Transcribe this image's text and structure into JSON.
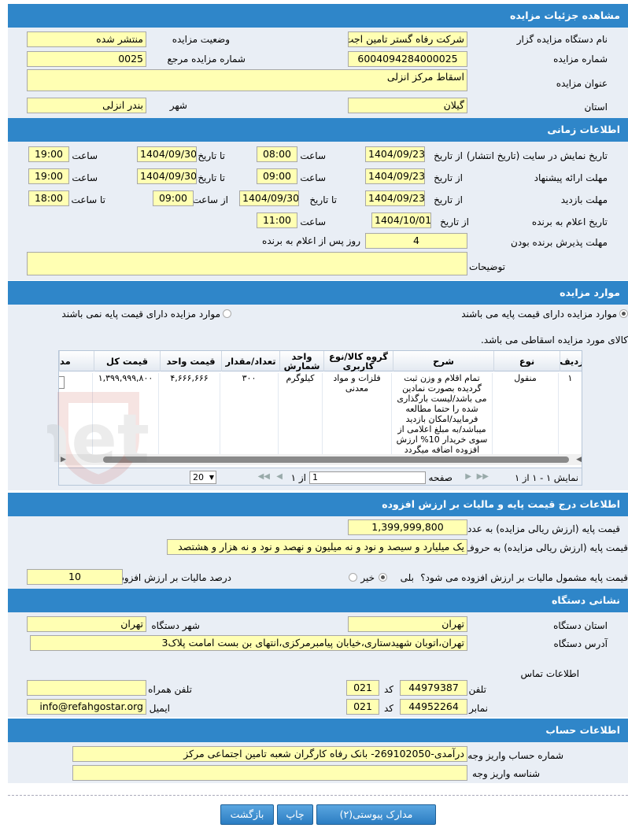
{
  "sections": {
    "details": "مشاهده جزئیات مزایده",
    "time": "اطلاعات زمانی",
    "items": "موارد مزایده",
    "price": "اطلاعات درج قیمت پایه و مالیات بر ارزش افزوده",
    "address": "نشانی دستگاه",
    "account": "اطلاعات حساب"
  },
  "details": {
    "org_label": "نام دستگاه مزایده گزار",
    "org_value": "شرکت رفاه گستر تامین اجت",
    "status_label": "وضعیت مزایده",
    "status_value": "منتشر شده",
    "number_label": "شماره مزایده",
    "number_value": "6004094284000025",
    "ref_label": "شماره مزایده مرجع",
    "ref_value": "0025",
    "title_label": "عنوان مزایده",
    "title_value": "اسقاط مرکز انزلی",
    "province_label": "استان",
    "province_value": "گیلان",
    "city_label": "شهر",
    "city_value": "بندر انزلی"
  },
  "time": {
    "display_label": "تاریخ نمایش در سایت (تاریخ انتشار)",
    "from_date": "از تاریخ",
    "to_date": "تا تاریخ",
    "hour": "ساعت",
    "from_hour": "از ساعت",
    "to_hour": "تا ساعت",
    "display_from": "1404/09/23",
    "display_from_time": "08:00",
    "display_to": "1404/09/30",
    "display_to_time": "19:00",
    "offer_label": "مهلت ارائه پیشنهاد",
    "offer_from": "1404/09/23",
    "offer_from_time": "09:00",
    "offer_to": "1404/09/30",
    "offer_to_time": "19:00",
    "visit_label": "مهلت بازدید",
    "visit_from": "1404/09/23",
    "visit_to": "1404/09/30",
    "visit_from_time": "09:00",
    "visit_to_time": "18:00",
    "winner_label": "تاریخ اعلام به برنده",
    "winner_date": "1404/10/01",
    "winner_time": "11:00",
    "accept_label": "مهلت پذیرش برنده بودن",
    "accept_value": "4",
    "accept_suffix": "روز پس از اعلام به برنده",
    "notes_label": "توضیحات",
    "notes_value": ""
  },
  "items": {
    "radio_with": "موارد مزایده دارای قیمت پایه می باشند",
    "radio_without": "موارد مزایده دارای قیمت پایه نمی باشند",
    "scrap_note": "کالای مورد مزایده اسقاطی می باشد.",
    "headers": {
      "row": "ردیف",
      "type": "نوع",
      "desc": "شرح",
      "group": "گروه کالا/نوع کاربری",
      "unit": "واحد شمارش",
      "qty": "تعداد/مقدار",
      "unit_price": "قیمت واحد",
      "total": "قیمت کل",
      "more": "مد"
    },
    "row": {
      "row": "۱",
      "type": "منقول",
      "desc": "تمام اقلام و وزن ثبت گردیده بصورت نمادین می باشد/لیست بارگذاری شده را حتما مطالعه فرمایید/امکان بازدید میباشد/به مبلغ اعلامی از سوی خریدار 10% ارزش افزوده اضافه میگردد",
      "group": "فلزات و مواد معدنی",
      "unit": "کیلوگرم",
      "qty": "۳۰۰",
      "unit_price": "۴,۶۶۶,۶۶۶",
      "total": "۱,۳۹۹,۹۹۹,۸۰۰"
    },
    "pager": {
      "page_label": "صفحه",
      "page_value": "1",
      "of_label": "از ۱",
      "size_value": "20",
      "summary": "نمایش ۱ - ۱ از ۱"
    }
  },
  "price": {
    "number_label": "قیمت پایه (ارزش ریالی مزایده) به عدد",
    "number_value": "1,399,999,800",
    "words_label": "قیمت پایه (ارزش ریالی مزایده) به حروف",
    "words_value": "یک میلیارد و سیصد و نود و نه میلیون و نهصد و نود و نه هزار و هشتصد",
    "vat_question": "قیمت پایه مشمول مالیات بر ارزش افزوده می شود؟",
    "yes": "بلی",
    "no": "خیر",
    "vat_pct_label": "درصد مالیات بر ارزش افزوده",
    "vat_pct_value": "10"
  },
  "address": {
    "province_label": "استان دستگاه",
    "province_value": "تهران",
    "city_label": "شهر دستگاه",
    "city_value": "تهران",
    "addr_label": "آدرس دستگاه",
    "addr_value": "تهران،اتوبان شهیدستاری،خیابان پیامبرمرکزی،انتهای بن بست امامت پلاک3",
    "contact_label": "اطلاعات تماس",
    "phone_label": "تلفن",
    "phone_value": "44979387",
    "code_label": "کد",
    "phone_code": "021",
    "mobile_label": "تلفن همراه",
    "mobile_value": "",
    "fax_label": "نمابر",
    "fax_value": "44952264",
    "fax_code": "021",
    "email_label": "ایمیل",
    "email_value": "info@refahgostar.org"
  },
  "account": {
    "account_label": "شماره حساب واریز وجه",
    "account_value": "درآمدی-269102050- بانک رفاه کارگران شعبه تامین اجتماعی مرکز",
    "id_label": "شناسه واریز وجه",
    "id_value": ""
  },
  "buttons": {
    "attachments": "مدارک پیوستی(۲)",
    "print": "چاپ",
    "back": "بازگشت"
  },
  "watermark": "AriaTender.net"
}
